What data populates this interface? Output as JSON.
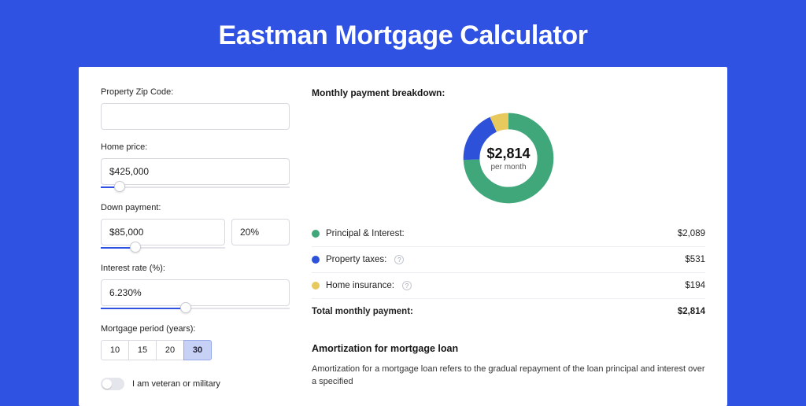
{
  "page": {
    "title": "Eastman Mortgage Calculator"
  },
  "form": {
    "zip_label": "Property Zip Code:",
    "zip_value": "",
    "home_price_label": "Home price:",
    "home_price_value": "$425,000",
    "home_price_slider_pct": 10,
    "down_payment_label": "Down payment:",
    "down_payment_value": "$85,000",
    "down_payment_pct_value": "20%",
    "down_payment_slider_pct": 28,
    "interest_label": "Interest rate (%):",
    "interest_value": "6.230%",
    "interest_slider_pct": 45,
    "period_label": "Mortgage period (years):",
    "periods": [
      "10",
      "15",
      "20",
      "30"
    ],
    "period_selected": "30",
    "veteran_label": "I am veteran or military",
    "veteran_on": false
  },
  "breakdown": {
    "title": "Monthly payment breakdown:",
    "center_amount": "$2,814",
    "center_sub": "per month",
    "items": [
      {
        "label": "Principal & Interest:",
        "value": "$2,089",
        "color": "#3fa77a",
        "help": false
      },
      {
        "label": "Property taxes:",
        "value": "$531",
        "color": "#2d52d9",
        "help": true
      },
      {
        "label": "Home insurance:",
        "value": "$194",
        "color": "#e8c95e",
        "help": true
      }
    ],
    "total_label": "Total monthly payment:",
    "total_value": "$2,814"
  },
  "chart_data": {
    "type": "pie",
    "title": "Monthly payment breakdown",
    "series": [
      {
        "name": "Principal & Interest",
        "value": 2089,
        "color": "#3fa77a"
      },
      {
        "name": "Property taxes",
        "value": 531,
        "color": "#2d52d9"
      },
      {
        "name": "Home insurance",
        "value": 194,
        "color": "#e8c95e"
      }
    ],
    "total": 2814,
    "center_label": "$2,814 per month"
  },
  "amortization": {
    "title": "Amortization for mortgage loan",
    "body": "Amortization for a mortgage loan refers to the gradual repayment of the loan principal and interest over a specified"
  }
}
